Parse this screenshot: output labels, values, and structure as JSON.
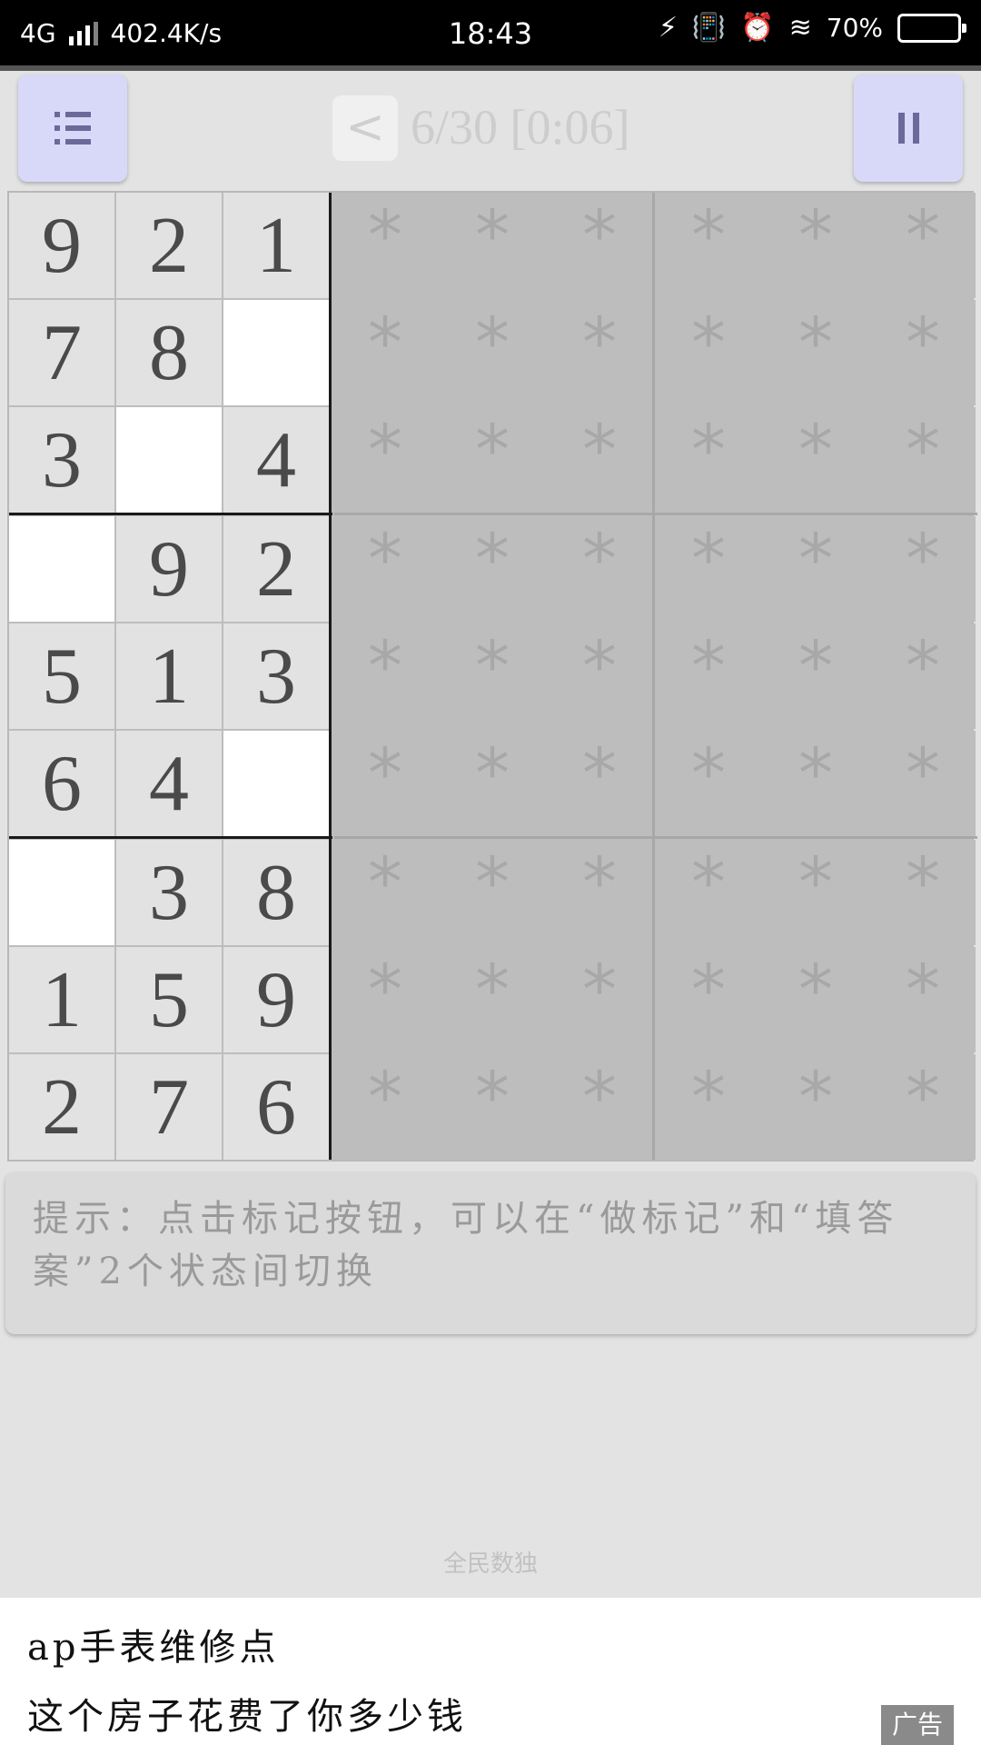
{
  "status_bar": {
    "network": "4G",
    "speed": "402.4K/s",
    "time": "18:43",
    "battery": "70%",
    "battery_level": 0.7,
    "icons": [
      "signal-icon",
      "charging-icon",
      "vibrate-icon",
      "alarm-icon",
      "wifi-icon",
      "battery-icon"
    ]
  },
  "toolbar": {
    "prev_label": "<",
    "progress": "6/30 [0:06]",
    "menu_icon": "list-icon",
    "pause_icon": "pause-icon"
  },
  "board": {
    "rows": [
      [
        "9",
        "2",
        "1",
        "*",
        "*",
        "*",
        "*",
        "*",
        "*"
      ],
      [
        "7",
        "8",
        "",
        "*",
        "*",
        "*",
        "*",
        "*",
        "*"
      ],
      [
        "3",
        "",
        "4",
        "*",
        "*",
        "*",
        "*",
        "*",
        "*"
      ],
      [
        "",
        "9",
        "2",
        "*",
        "*",
        "*",
        "*",
        "*",
        "*"
      ],
      [
        "5",
        "1",
        "3",
        "*",
        "*",
        "*",
        "*",
        "*",
        "*"
      ],
      [
        "6",
        "4",
        "",
        "*",
        "*",
        "*",
        "*",
        "*",
        "*"
      ],
      [
        "",
        "3",
        "8",
        "*",
        "*",
        "*",
        "*",
        "*",
        "*"
      ],
      [
        "1",
        "5",
        "9",
        "*",
        "*",
        "*",
        "*",
        "*",
        "*"
      ],
      [
        "2",
        "7",
        "6",
        "*",
        "*",
        "*",
        "*",
        "*",
        "*"
      ]
    ]
  },
  "hint": "提示：点击标记按钮，可以在“做标记”和“填答案”2个状态间切换",
  "app_name": "全民数独",
  "ad": {
    "line1": "ap手表维修点",
    "line2": "这个房子花费了你多少钱",
    "badge": "广告"
  },
  "colors": {
    "button_bg": "#d8d8f8",
    "given_cell": "#e2e2e2",
    "empty_cell": "#ffffff",
    "hidden_cell": "#bdbdbd"
  }
}
